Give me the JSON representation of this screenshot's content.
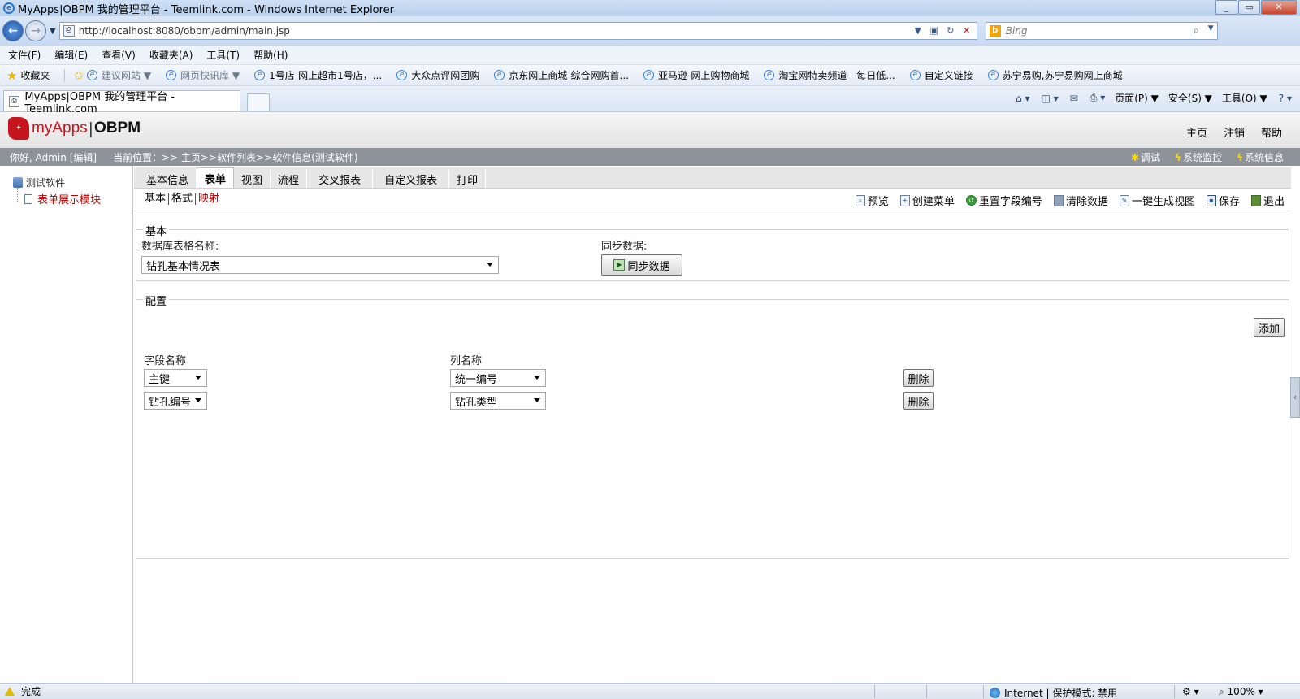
{
  "window": {
    "title": "MyApps|OBPM 我的管理平台 - Teemlink.com - Windows Internet Explorer"
  },
  "browser": {
    "url": "http://localhost:8080/obpm/admin/main.jsp",
    "search_placeholder": "Bing",
    "menu": [
      "文件(F)",
      "编辑(E)",
      "查看(V)",
      "收藏夹(A)",
      "工具(T)",
      "帮助(H)"
    ],
    "favorites_label": "收藏夹",
    "favorites": [
      "建议网站 ▼",
      "网页快讯库 ▼",
      "1号店-网上超市1号店，...",
      "大众点评网团购",
      "京东网上商城-综合网购首...",
      "亚马逊-网上购物商城",
      "淘宝网特卖频道 - 每日低...",
      "自定义链接",
      "苏宁易购,苏宁易购网上商城"
    ],
    "tab_title": "MyApps|OBPM 我的管理平台 - Teemlink.com",
    "commands": [
      "页面(P) ▼",
      "安全(S) ▼",
      "工具(O) ▼"
    ],
    "status_text": "完成",
    "zone_text": "Internet | 保护模式: 禁用",
    "zoom_text": "100%"
  },
  "app": {
    "logo_text": "myApps",
    "logo_product": "OBPM",
    "top_links": [
      "主页",
      "注销",
      "帮助"
    ],
    "greeting": "你好, Admin [编辑]",
    "location": "当前位置：>> 主页>>软件列表>>软件信息(测试软件)",
    "tools": [
      "调试",
      "系统监控",
      "系统信息"
    ]
  },
  "tree": {
    "root": "测试软件",
    "child": "表单展示模块"
  },
  "main_tabs": [
    "基本信息",
    "表单",
    "视图",
    "流程",
    "交叉报表",
    "自定义报表",
    "打印"
  ],
  "active_tab": "表单",
  "sub_tabs": [
    "基本",
    "格式",
    "映射"
  ],
  "active_sub_tab": "映射",
  "actions": [
    "预览",
    "创建菜单",
    "重置字段编号",
    "清除数据",
    "一键生成视图",
    "保存",
    "退出"
  ],
  "basic_section": {
    "legend": "基本",
    "table_label": "数据库表格名称:",
    "table_value": "钻孔基本情况表",
    "sync_label": "同步数据:",
    "sync_button": "同步数据"
  },
  "config_section": {
    "legend": "配置",
    "add_button": "添加",
    "field_header": "字段名称",
    "column_header": "列名称",
    "delete_label": "删除",
    "rows": [
      {
        "field": "主键",
        "column": "统一编号"
      },
      {
        "field": "钻孔编号",
        "column": "钻孔类型"
      }
    ]
  }
}
